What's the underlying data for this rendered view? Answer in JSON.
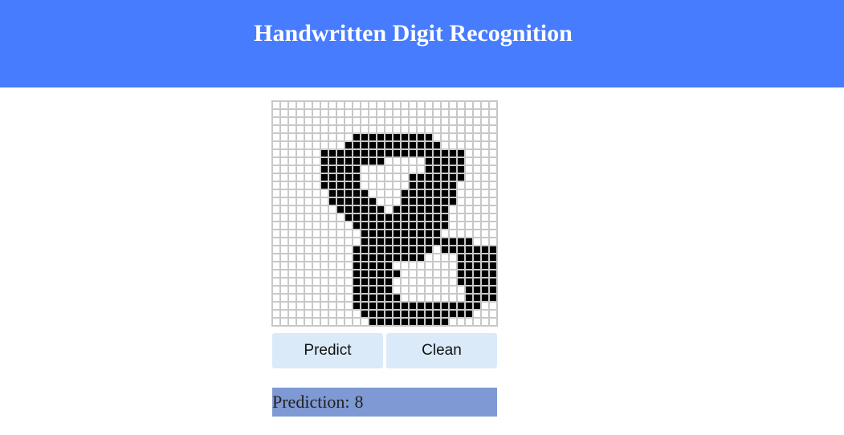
{
  "header": {
    "title": "Handwritten Digit Recognition"
  },
  "canvas": {
    "rows": 28,
    "cols": 28,
    "on_color": "#000000",
    "off_color": "#ffffff",
    "grid_line_color": "#c8c8c8",
    "pixels": [
      "............................",
      "............................",
      "............................",
      "............................",
      "..........##########........",
      ".........############.......",
      "......##################....",
      "......########.....#####....",
      "......#####........#####....",
      "......#####......#######....",
      "......#####......######.....",
      ".......#####....#######.....",
      ".......######...#######.....",
      "........######.#######......",
      ".........#############......",
      "..........############......",
      "...........##########.......",
      "...........##############...",
      "..........##########.#######",
      "..........#########....#####",
      "..........#####........#####",
      "..........######.......#####",
      "..........#####........#####",
      "..........#####.........####",
      "..........######........####",
      "..........################..",
      "...........##############...",
      "............##########......"
    ]
  },
  "buttons": {
    "predict_label": "Predict",
    "clean_label": "Clean"
  },
  "prediction": {
    "label": "Prediction:",
    "value": "8"
  },
  "colors": {
    "header_bg": "#477cff",
    "button_bg": "#daeaf9",
    "prediction_bg": "#7e99d3"
  }
}
